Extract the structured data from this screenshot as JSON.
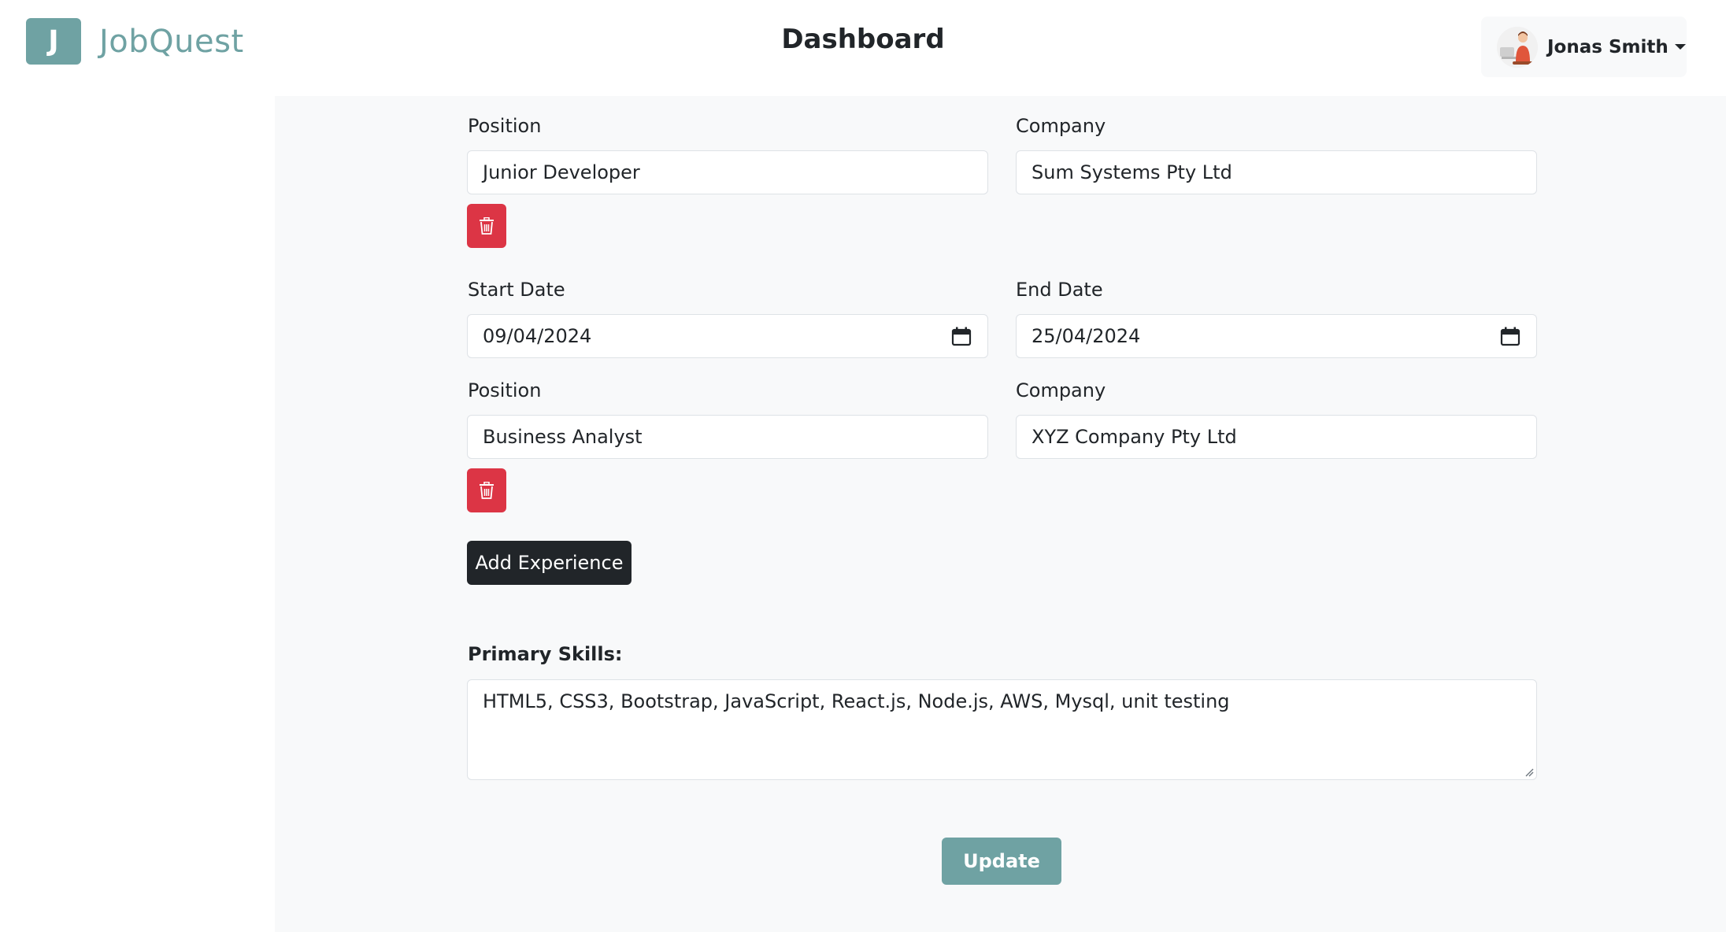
{
  "app": {
    "logo_letter": "J",
    "logo_name": "JobQuest",
    "brand_color": "#6fa2a3"
  },
  "header": {
    "title": "Dashboard",
    "user": {
      "name": "Jonas Smith",
      "avatar_icon": "user-avatar"
    }
  },
  "experience": {
    "entries": [
      {
        "position_label": "Position",
        "position_value": "Junior Developer",
        "company_label": "Company",
        "company_value": "Sum Systems Pty Ltd"
      },
      {
        "position_label": "Position",
        "position_value": "Business Analyst",
        "company_label": "Company",
        "company_value": "XYZ Company Pty Ltd"
      }
    ],
    "dates": {
      "start_label": "Start Date",
      "start_value": "09/04/2024",
      "end_label": "End Date",
      "end_value": "25/04/2024"
    },
    "delete_icon": "trash-icon",
    "delete_color": "#dc3545",
    "add_label": "Add Experience"
  },
  "skills": {
    "label": "Primary Skills:",
    "value": "HTML5, CSS3, Bootstrap, JavaScript, React.js, Node.js, AWS, Mysql, unit testing"
  },
  "actions": {
    "update_label": "Update"
  }
}
